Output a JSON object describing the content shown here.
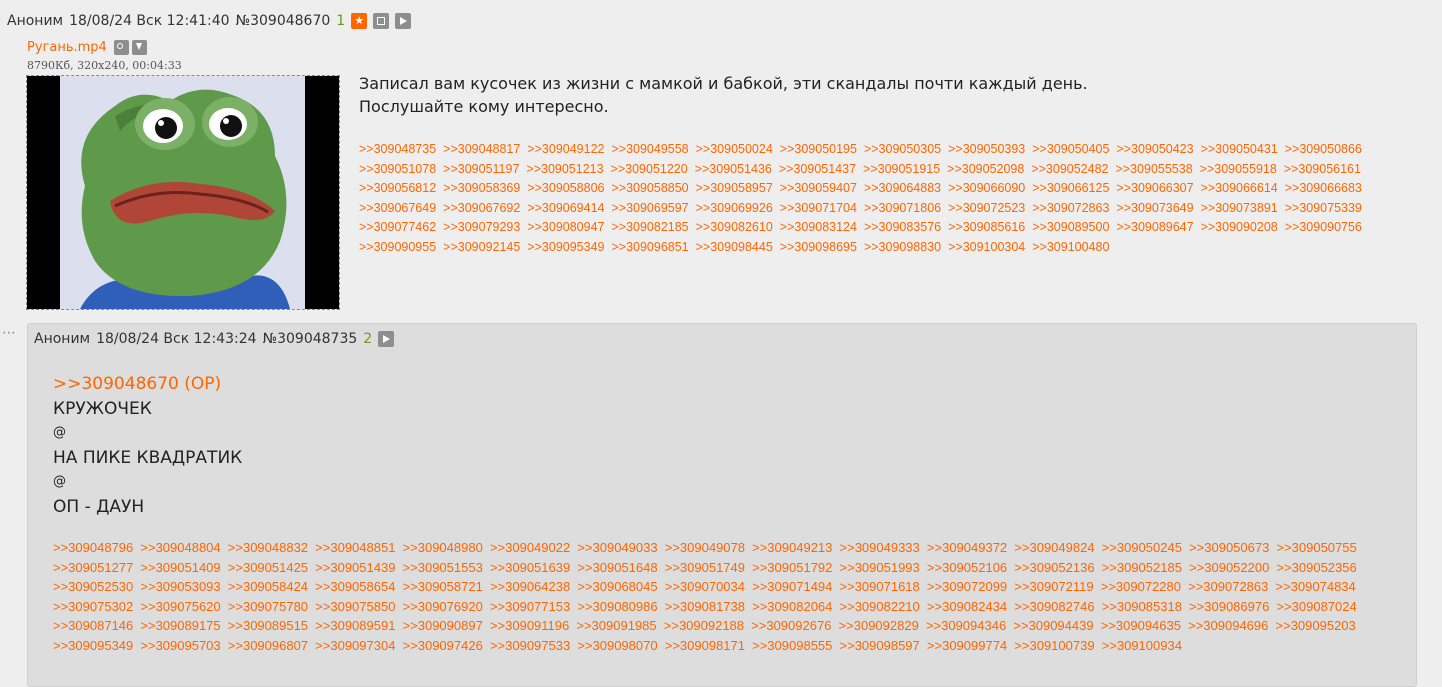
{
  "op": {
    "author": "Аноним",
    "datetime": "18/08/24 Вск 12:41:40",
    "number": "№309048670",
    "count": "1",
    "file": {
      "name": "Ругань.mp4",
      "meta": "8790Кб, 320x240, 00:04:33"
    },
    "text": [
      "Записал вам кусочек из жизни с мамкой и бабкой, эти скандалы почти каждый день.",
      "Послушайте кому интересно."
    ],
    "replies": [
      ">>309048735",
      ">>309048817",
      ">>309049122",
      ">>309049558",
      ">>309050024",
      ">>309050195",
      ">>309050305",
      ">>309050393",
      ">>309050405",
      ">>309050423",
      ">>309050431",
      ">>309050866",
      ">>309051078",
      ">>309051197",
      ">>309051213",
      ">>309051220",
      ">>309051436",
      ">>309051437",
      ">>309051915",
      ">>309052098",
      ">>309052482",
      ">>309055538",
      ">>309055918",
      ">>309056161",
      ">>309056812",
      ">>309058369",
      ">>309058806",
      ">>309058850",
      ">>309058957",
      ">>309059407",
      ">>309064883",
      ">>309066090",
      ">>309066125",
      ">>309066307",
      ">>309066614",
      ">>309066683",
      ">>309067649",
      ">>309067692",
      ">>309069414",
      ">>309069597",
      ">>309069926",
      ">>309071704",
      ">>309071806",
      ">>309072523",
      ">>309072863",
      ">>309073649",
      ">>309073891",
      ">>309075339",
      ">>309077462",
      ">>309079293",
      ">>309080947",
      ">>309082185",
      ">>309082610",
      ">>309083124",
      ">>309083576",
      ">>309085616",
      ">>309089500",
      ">>309089647",
      ">>309090208",
      ">>309090756",
      ">>309090955",
      ">>309092145",
      ">>309095349",
      ">>309096851",
      ">>309098445",
      ">>309098695",
      ">>309098830",
      ">>309100304",
      ">>309100480"
    ]
  },
  "reply": {
    "author": "Аноним",
    "datetime": "18/08/24 Вск 12:43:24",
    "number": "№309048735",
    "count": "2",
    "quote": ">>309048670 (OP)",
    "lines": [
      "КРУЖОЧЕК",
      "@",
      "НА ПИКЕ КВАДРАТИК",
      "@",
      "ОП - ДАУН"
    ],
    "replies": [
      ">>309048796",
      ">>309048804",
      ">>309048832",
      ">>309048851",
      ">>309048980",
      ">>309049022",
      ">>309049033",
      ">>309049078",
      ">>309049213",
      ">>309049333",
      ">>309049372",
      ">>309049824",
      ">>309050245",
      ">>309050673",
      ">>309050755",
      ">>309051277",
      ">>309051409",
      ">>309051425",
      ">>309051439",
      ">>309051553",
      ">>309051639",
      ">>309051648",
      ">>309051749",
      ">>309051792",
      ">>309051993",
      ">>309052106",
      ">>309052136",
      ">>309052185",
      ">>309052200",
      ">>309052356",
      ">>309052530",
      ">>309053093",
      ">>309058424",
      ">>309058654",
      ">>309058721",
      ">>309064238",
      ">>309068045",
      ">>309070034",
      ">>309071494",
      ">>309071618",
      ">>309072099",
      ">>309072119",
      ">>309072280",
      ">>309072863",
      ">>309074834",
      ">>309075302",
      ">>309075620",
      ">>309075780",
      ">>309075850",
      ">>309076920",
      ">>309077153",
      ">>309080986",
      ">>309081738",
      ">>309082064",
      ">>309082210",
      ">>309082434",
      ">>309082746",
      ">>309085318",
      ">>309086976",
      ">>309087024",
      ">>309087146",
      ">>309089175",
      ">>309089515",
      ">>309089591",
      ">>309090897",
      ">>309091196",
      ">>309091985",
      ">>309092188",
      ">>309092676",
      ">>309092829",
      ">>309094346",
      ">>309094439",
      ">>309094635",
      ">>309094696",
      ">>309095203",
      ">>309095349",
      ">>309095703",
      ">>309096807",
      ">>309097304",
      ">>309097426",
      ">>309097533",
      ">>309098070",
      ">>309098171",
      ">>309098555",
      ">>309098597",
      ">>309099774",
      ">>309100739",
      ">>309100934"
    ]
  },
  "icons": {
    "favorite": "star-icon",
    "expand": "expand-icon",
    "play": "play-icon",
    "search": "search-icon",
    "download": "download-icon",
    "menu": "ellipsis-icon"
  },
  "colors": {
    "background": "#eeeeee",
    "reply_background": "#dddddd",
    "link": "#ff6600",
    "count": "#6a9c1e"
  }
}
